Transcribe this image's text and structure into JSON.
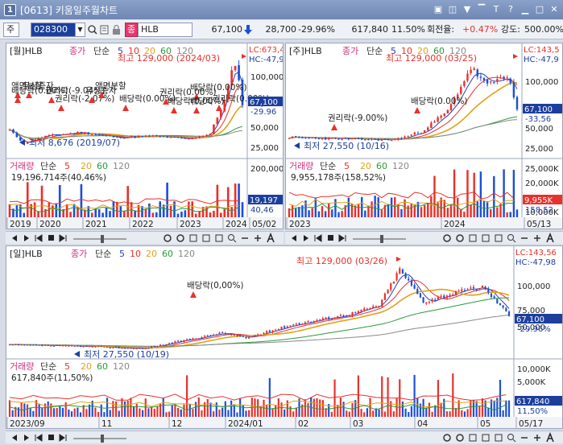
{
  "window": {
    "number": "1",
    "title": "[0613] 키움일주월차트",
    "buttons": [
      "▣",
      "◫",
      "▼",
      "▔",
      "T",
      "?",
      "▁",
      "□",
      "✕"
    ]
  },
  "toolbar": {
    "market": "주",
    "code": "028300",
    "dropdown_arrow": "▼",
    "icons": [
      "search-icon",
      "magnifier-icon",
      "lock-icon"
    ],
    "badge": "종",
    "name": "HLB",
    "price": "67,100",
    "change": "28,700",
    "change_pct": "-29.96%",
    "volume": "617,840",
    "vol_pct": "11.50%",
    "turnover_label": "회전율:",
    "turnover": "+0.47%",
    "strength_label": "강도:",
    "strength": "500.00%"
  },
  "colors": {
    "up": "#e8312b",
    "down": "#1d4fd8",
    "ma5": "#2b3fb5",
    "ma10": "#e8312b",
    "ma20": "#e0a21a",
    "ma60": "#2a9a3a",
    "ma120": "#8a8a8a",
    "accent_blue": "#1c3f9e"
  },
  "panes": [
    {
      "id": "monthly",
      "title": "[월]HLB",
      "legend": [
        "종가",
        "단순",
        "5",
        "10",
        "20",
        "60",
        "120"
      ],
      "high_label": "최고 129,000 (2024/03)",
      "low_label": "최저 8,676 (2019/07)",
      "annotations": [
        "액면분할",
        "무상증자",
        "권리락(-9.04%)",
        "배당락(0.00%)",
        "권리락(-2.07%)",
        "액면분할",
        "유상증자",
        "배당락(0.00%)",
        "권리락(0.00%)",
        "배당락(0.00%)",
        "배당락(0.00%)",
        "권리락(0.00%)",
        "배당락"
      ],
      "lc": "LC:673,4",
      "hc": "HC:-47,9",
      "y_ticks": [
        "100,000",
        "75,000",
        "50,000",
        "25,000",
        "0"
      ],
      "price_box": "67,100",
      "pct_box": "-29.96",
      "vol_title": "거래량",
      "vol_legend": [
        "단순",
        "5",
        "20",
        "60",
        "120"
      ],
      "vol_info": "19,196,714주(40,46%)",
      "vol_ticks": [
        "200,000"
      ],
      "vol_box": "19,197",
      "vol_pct_box": "40,46",
      "x_labels": [
        "2019",
        "2020",
        "2021",
        "2022",
        "2023",
        "2024",
        "05/02"
      ]
    },
    {
      "id": "weekly",
      "title": "[주]HLB",
      "legend": [
        "종가",
        "단순",
        "5",
        "10",
        "20",
        "60",
        "120"
      ],
      "high_label": "최고 129,000 (03/25)",
      "low_label": "최저 27,550 (10/16)",
      "annotations": [
        "배당락(0.00%)",
        "권리락(-9.00%)"
      ],
      "lc": "LC:143,5",
      "hc": "HC:-47,9",
      "y_ticks": [
        "100,000",
        "75,000",
        "50,000",
        "25,000"
      ],
      "price_box": "67,100",
      "pct_box": "-33,56",
      "vol_title": "거래량",
      "vol_legend": [
        "단순",
        "5",
        "20",
        "60",
        "120"
      ],
      "vol_info": "9,955,178주(158,52%)",
      "vol_ticks": [
        "25,000K",
        "20,000K",
        "15,000K",
        "10,000K"
      ],
      "vol_box": "9,955K",
      "vol_pct_box": "158,52",
      "x_labels": [
        "2023",
        "2024",
        "05/13"
      ]
    },
    {
      "id": "daily",
      "title": "[일]HLB",
      "legend": [
        "종가",
        "단순",
        "5",
        "10",
        "20",
        "60",
        "120"
      ],
      "high_label": "최고 129,000 (03/26)",
      "low_label": "최저 27,550 (10/19)",
      "annotations": [
        "배당락(0,00%)"
      ],
      "lc": "LC:143,56",
      "hc": "HC:-47,98",
      "y_ticks": [
        "100,000",
        "75,000",
        "50,000"
      ],
      "price_box": "67,100",
      "pct_box": "-29.96%",
      "vol_title": "거래량",
      "vol_legend": [
        "단순",
        "5",
        "20",
        "60",
        "120"
      ],
      "vol_info": "617,840주(11,50%)",
      "vol_ticks": [
        "10,000K",
        "5,000K"
      ],
      "vol_box": "617,840",
      "vol_pct_box": "11,50%",
      "x_labels": [
        "2023/09",
        "11",
        "12",
        "2024/01",
        "02",
        "03",
        "04",
        "05",
        "05/17"
      ]
    }
  ]
}
